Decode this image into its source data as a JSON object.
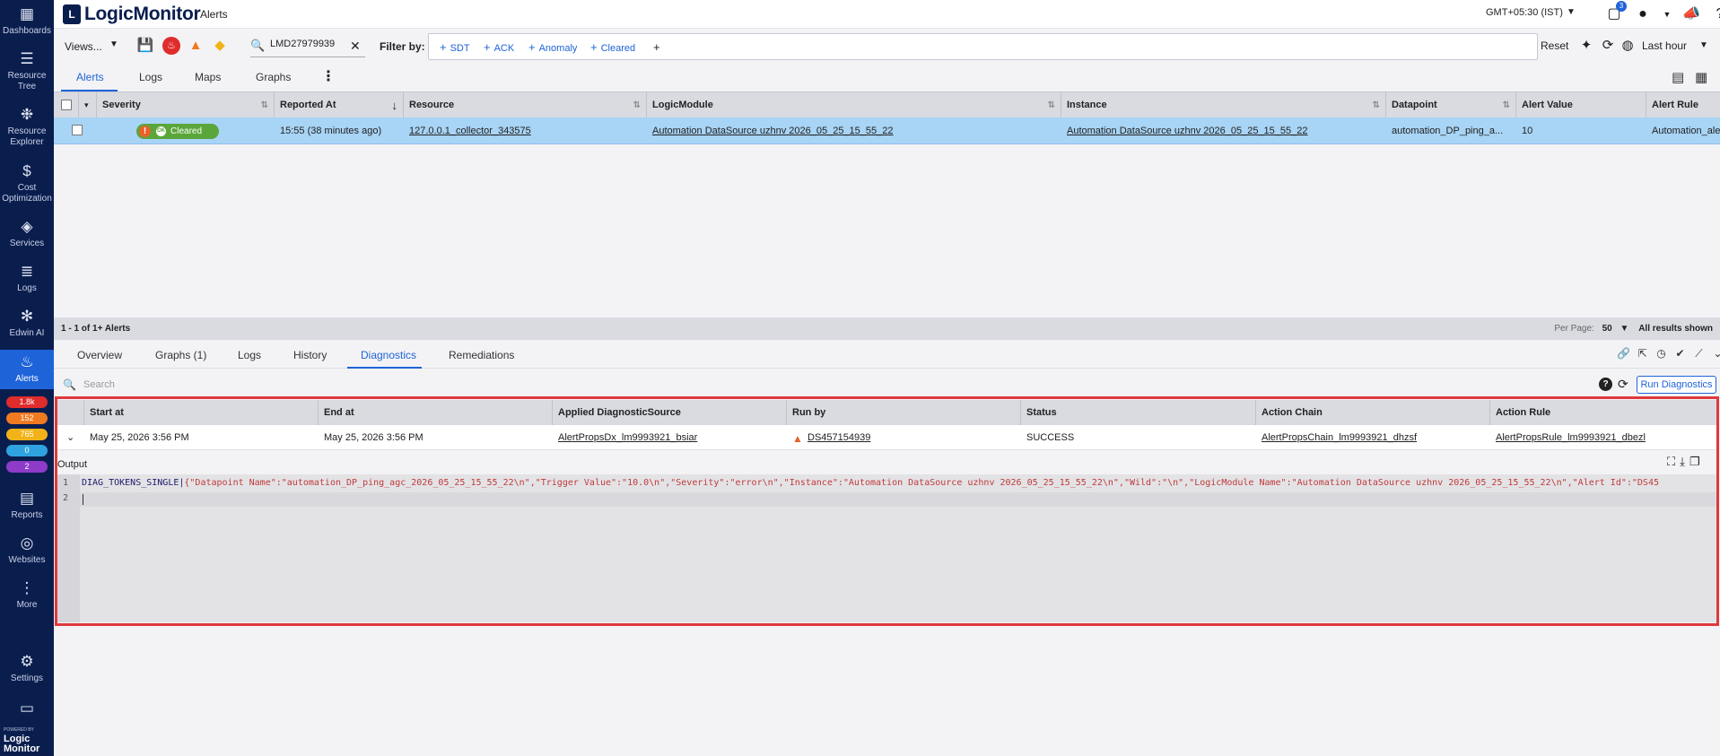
{
  "sidebar": {
    "items": [
      {
        "label": "Dashboards",
        "icon": "dashboards-icon",
        "glyph": "▦"
      },
      {
        "label": "Resource Tree",
        "icon": "resource-tree-icon",
        "glyph": "☰"
      },
      {
        "label": "Resource Explorer",
        "icon": "resource-explorer-icon",
        "glyph": "❉"
      },
      {
        "label": "Cost Optimization",
        "icon": "cost-optimization-icon",
        "glyph": "$"
      },
      {
        "label": "Services",
        "icon": "services-icon",
        "glyph": "◈"
      },
      {
        "label": "Logs",
        "icon": "logs-icon",
        "glyph": "≣"
      },
      {
        "label": "Edwin AI",
        "icon": "edwin-ai-icon",
        "glyph": "✻"
      },
      {
        "label": "Alerts",
        "icon": "alerts-icon",
        "glyph": "♨"
      },
      {
        "label": "Reports",
        "icon": "reports-icon",
        "glyph": "▤"
      },
      {
        "label": "Websites",
        "icon": "websites-icon",
        "glyph": "◎"
      },
      {
        "label": "More",
        "icon": "more-icon",
        "glyph": "⋮"
      },
      {
        "label": "Settings",
        "icon": "settings-icon",
        "glyph": "⚙"
      },
      {
        "label": "",
        "icon": "monitor-icon",
        "glyph": "▭"
      }
    ],
    "alert_counts": [
      {
        "value": "1.8k",
        "color": "#e02c2c"
      },
      {
        "value": "152",
        "color": "#f07a20"
      },
      {
        "value": "765",
        "color": "#f2b318"
      },
      {
        "value": "0",
        "color": "#2fa3e0"
      },
      {
        "value": "2",
        "color": "#8e3bc9"
      }
    ],
    "logo_powered": "POWERED BY",
    "logo_name": "Logic Monitor"
  },
  "topbar": {
    "brand": "LogicMonitor",
    "page": "Alerts",
    "timezone": "GMT+05:30 (IST)",
    "notification_count": "3"
  },
  "toolbar": {
    "views_label": "Views...",
    "search_value": "LMD27979939",
    "filter_label": "Filter by:",
    "chips": [
      "SDT",
      "ACK",
      "Anomaly",
      "Cleared"
    ],
    "reset_label": "Reset",
    "time_range": "Last hour"
  },
  "tabs": [
    "Alerts",
    "Logs",
    "Maps",
    "Graphs"
  ],
  "alerts_table": {
    "columns": [
      "Severity",
      "Reported At",
      "Resource",
      "LogicModule",
      "Instance",
      "Datapoint",
      "Alert Value",
      "Alert Rule"
    ],
    "rows": [
      {
        "severity": "Cleared",
        "severity_badge": "OK",
        "reported_at": "15:55  (38 minutes ago)",
        "resource": "127.0.0.1_collector_343575",
        "logicmodule": "Automation DataSource uzhnv 2026_05_25_15_55_22",
        "instance": "Automation DataSource uzhnv 2026_05_25_15_55_22",
        "datapoint": "automation_DP_ping_a...",
        "alert_value": "10",
        "alert_rule": "Automation_alertRule_nx..."
      }
    ],
    "summary": "1 - 1 of 1+ Alerts",
    "per_page_label": "Per Page:",
    "per_page_value": "50",
    "results_label": "All results shown"
  },
  "detail": {
    "tabs": [
      "Overview",
      "Graphs (1)",
      "Logs",
      "History",
      "Diagnostics",
      "Remediations"
    ],
    "search_placeholder": "Search",
    "run_button": "Run Diagnostics",
    "columns": [
      "Start at",
      "End at",
      "Applied DiagnosticSource",
      "Run by",
      "Status",
      "Action Chain",
      "Action Rule"
    ],
    "rows": [
      {
        "start_at": "May 25, 2026 3:56 PM",
        "end_at": "May 25, 2026 3:56 PM",
        "source": "AlertPropsDx_lm9993921_bsiar",
        "run_by": "DS457154939",
        "status": "SUCCESS",
        "action_chain": "AlertPropsChain_lm9993921_dhzsf",
        "action_rule": "AlertPropsRule_lm9993921_dbezl"
      }
    ],
    "output_label": "Output",
    "code_lines": [
      {
        "number": "1",
        "prefix": "DIAG_TOKENS_SINGLE|",
        "text": "{\"Datapoint Name\":\"automation_DP_ping_agc_2026_05_25_15_55_22\\n\",\"Trigger Value\":\"10.0\\n\",\"Severity\":\"error\\n\",\"Instance\":\"Automation DataSource uzhnv 2026_05_25_15_55_22\\n\",\"Wild\":\"\\n\",\"LogicModule Name\":\"Automation DataSource uzhnv 2026_05_25_15_55_22\\n\",\"Alert Id\":\"DS45"
      },
      {
        "number": "2",
        "prefix": "",
        "text": ""
      }
    ]
  }
}
